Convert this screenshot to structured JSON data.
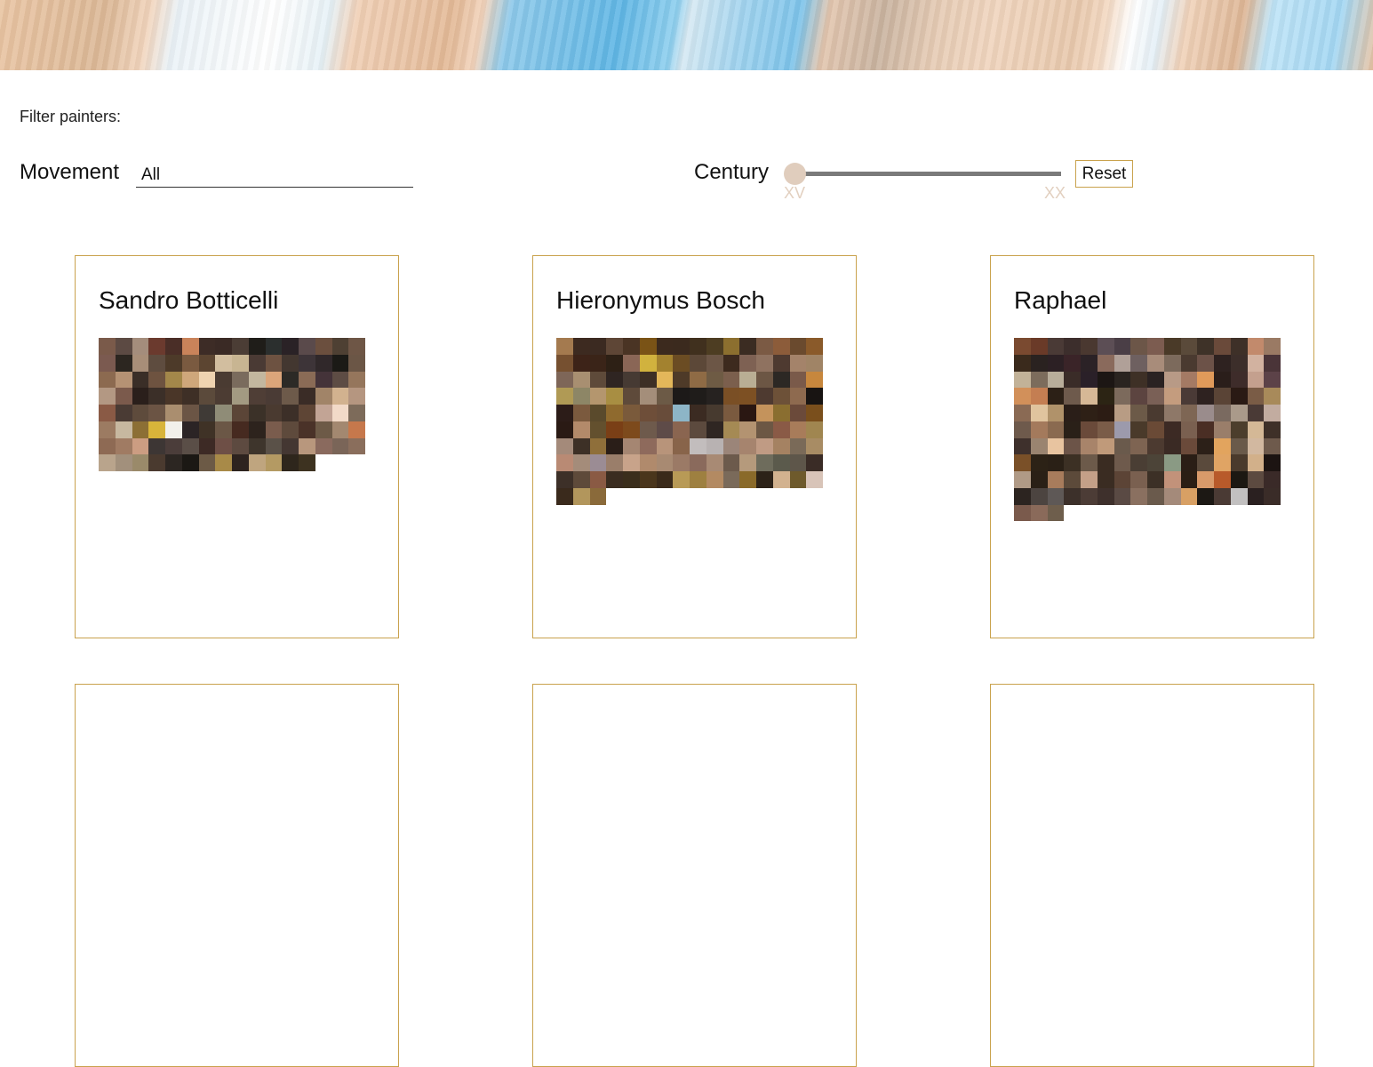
{
  "filters": {
    "heading": "Filter painters:",
    "movement_label": "Movement",
    "movement_value": "All",
    "century_label": "Century",
    "century_min_label": "XV",
    "century_max_label": "XX",
    "century_selected": "XV",
    "reset_label": "Reset"
  },
  "colors": {
    "accent_border": "#c9a24d",
    "slider_thumb": "#e0cdbd",
    "slider_track": "#7a7a7a",
    "tick_label": "#e2d0c0"
  },
  "painters": [
    {
      "name": "Sandro Botticelli",
      "palette": [
        "#7a5a4a",
        "#5c4a43",
        "#a48d7c",
        "#6b3a2e",
        "#4a2e27",
        "#c9835a",
        "#3d2c26",
        "#3a2a25",
        "#4b3d35",
        "#1f1d19",
        "#2b2f2e",
        "#2a2226",
        "#5a4a4b",
        "#6b4f3e",
        "#4e4033",
        "#6e5646",
        "#7b5a50",
        "#2c2620",
        "#a88e78",
        "#5e4c3f",
        "#4d3a29",
        "#7a5a40",
        "#5c4531",
        "#d2be9f",
        "#c8b592",
        "#4a3a34",
        "#6d5241",
        "#433730",
        "#3d3438",
        "#30282a",
        "#1b1a16",
        "#6b5646",
        "#8c6a50",
        "#b59274",
        "#3a2e27",
        "#6e5340",
        "#a3874a",
        "#cfa77b",
        "#efd3b0",
        "#4a3b32",
        "#7a6b5d",
        "#c3b79f",
        "#dba57a",
        "#2c2a26",
        "#8a6b56",
        "#443339",
        "#5d4c44",
        "#95765c",
        "#b39883",
        "#7b5a4c",
        "#2a1f1b",
        "#3b2f28",
        "#4a3628",
        "#3e2f26",
        "#5b4a3b",
        "#4c3c33",
        "#a39a82",
        "#4f3e36",
        "#4a3b35",
        "#6d5a4a",
        "#3a2c26",
        "#a18468",
        "#d2b28f",
        "#b59680",
        "#8a5a45",
        "#4a3b34",
        "#5e4b3c",
        "#6b5444",
        "#aa8e6f",
        "#6b5545",
        "#3f3a36",
        "#8f8c77",
        "#5b4537",
        "#3b3128",
        "#4a3a30",
        "#3c2f28",
        "#5e4535",
        "#c2a495",
        "#f2dac8",
        "#7d6b5a",
        "#9c7b62",
        "#c7b8a0",
        "#8c6f35",
        "#d8b43a",
        "#f2f0ea",
        "#2b2425",
        "#3f3226",
        "#6b5746",
        "#462a20",
        "#2d231d",
        "#7a5c4d",
        "#5e4a3c",
        "#4a3228",
        "#6d5a47",
        "#a38870",
        "#c6784c",
        "#8e6a54",
        "#a07b63",
        "#cc9d82",
        "#3d3634",
        "#4b3d3a",
        "#5a4e47",
        "#3d2a25",
        "#6e4f46",
        "#5d4a40",
        "#3e352c",
        "#5a5148",
        "#443732",
        "#b8977d",
        "#8a6a5e",
        "#7a6558",
        "#8a6e5c",
        "#b9a48c",
        "#a2907c",
        "#9a8a6a",
        "#4a3a2f",
        "#2c2622",
        "#1b1814",
        "#6c5a46",
        "#a88a48",
        "#2d231f",
        "#bfa57f",
        "#b49a63",
        "#2e261c",
        "#3d3220"
      ]
    },
    {
      "name": "Hieronymus Bosch",
      "palette": [
        "#a47a4f",
        "#3d2a20",
        "#3b2a21",
        "#5e4636",
        "#4a3424",
        "#7a5316",
        "#3c2a1e",
        "#3b2a1e",
        "#40301e",
        "#4d3d22",
        "#8c6f2f",
        "#3b2c22",
        "#7b5a44",
        "#8c5c3a",
        "#6a4a2e",
        "#8a5a2a",
        "#765030",
        "#3d2318",
        "#3a2418",
        "#2d2015",
        "#8a6656",
        "#d1b23e",
        "#a3822f",
        "#6b4c23",
        "#5c4838",
        "#6c5646",
        "#3d2a1e",
        "#7e6153",
        "#8f7260",
        "#4e3a30",
        "#a4836a",
        "#a08466",
        "#7e6658",
        "#a88f71",
        "#5e4a3a",
        "#2f2522",
        "#463a33",
        "#3d2f25",
        "#e3b75a",
        "#4e3a28",
        "#8f6b45",
        "#6e5b44",
        "#7b5f4d",
        "#b9ae94",
        "#6c5644",
        "#2c2824",
        "#7a5a4a",
        "#c7873d",
        "#b09a55",
        "#8d8666",
        "#b4966e",
        "#a88e42",
        "#5e4a3a",
        "#a48e7a",
        "#6c5a46",
        "#1c1918",
        "#1f1c1a",
        "#262220",
        "#7a4f25",
        "#7d5023",
        "#4e3a30",
        "#6d5138",
        "#8e6a4f",
        "#181412",
        "#2c1c18",
        "#7b5a3e",
        "#5a4a2c",
        "#8f6a2e",
        "#7a5a3b",
        "#6e4e39",
        "#684c3a",
        "#8db5c7",
        "#3b2b22",
        "#473a2f",
        "#7a5a3f",
        "#2a1712",
        "#c4935c",
        "#8a6e30",
        "#6b4a3a",
        "#7a4f1c",
        "#2a1a14",
        "#b38a6a",
        "#63502e",
        "#7a3f16",
        "#7d4a1c",
        "#6e5a4c",
        "#5e4b48",
        "#8a6550",
        "#5c4a3e",
        "#2f2622",
        "#a58a54",
        "#b39371",
        "#6c5744",
        "#8a5a46",
        "#a87c5a",
        "#a08650",
        "#a48a7a",
        "#3d3026",
        "#8f6f3a",
        "#2a1e18",
        "#a58672",
        "#8e6a5c",
        "#b8947a",
        "#88644a",
        "#c2bdbd",
        "#b8b2b2",
        "#9b8579",
        "#a6846e",
        "#c09b84",
        "#a58262",
        "#7a6a58",
        "#a88c64",
        "#b98a74",
        "#a48c7a",
        "#9b8c94",
        "#9a7e6a",
        "#c8a38a",
        "#b08a6c",
        "#a88a72",
        "#9b7a66",
        "#8a6a5c",
        "#a88a74",
        "#6c5a4c",
        "#b59a7c",
        "#6e6c5c",
        "#5b5a4c",
        "#5e564a",
        "#3a2c26",
        "#3d3028",
        "#5e4a3a",
        "#8a5a44",
        "#3a2c20",
        "#3a2e1c",
        "#4a361c",
        "#3a2a1a",
        "#b89a56",
        "#9e8040",
        "#b38a62",
        "#7a6a5a",
        "#8a6a2a",
        "#2c2218",
        "#d2b28f",
        "#6e5a2c",
        "#d8c4b8",
        "#3a2a1c",
        "#b2965c",
        "#8a6a3a"
      ]
    },
    {
      "name": "Raphael",
      "palette": [
        "#7a4a30",
        "#6a3a28",
        "#4a3a36",
        "#3c2e2c",
        "#4a3830",
        "#5c4e55",
        "#4a3e46",
        "#6c5648",
        "#7c5c50",
        "#4a3a28",
        "#5a4a3a",
        "#3e3228",
        "#6a4a3a",
        "#3e3028",
        "#c28a6c",
        "#9a7a64",
        "#3a2a1c",
        "#2a2220",
        "#2c2024",
        "#3a2428",
        "#2b2226",
        "#8a6a5c",
        "#b0a098",
        "#6e6060",
        "#a88c7a",
        "#7c6a5c",
        "#4a3a30",
        "#6c5248",
        "#2e2220",
        "#3c2e2a",
        "#d2b2a0",
        "#4a3438",
        "#c2b298",
        "#7c6c5c",
        "#b8ad9a",
        "#3a2c28",
        "#2a2028",
        "#1c1614",
        "#2a2420",
        "#3e3026",
        "#2a2222",
        "#b89a86",
        "#a47a64",
        "#e09a5a",
        "#2a1e1a",
        "#3e2c2a",
        "#c4a08e",
        "#5c4248",
        "#d2905a",
        "#c47e52",
        "#2c2016",
        "#6e5a4c",
        "#d6b896",
        "#2c2414",
        "#7c6a5c",
        "#5c4440",
        "#7a6056",
        "#c49c7e",
        "#4a3a36",
        "#2e2220",
        "#5a4436",
        "#2a1a14",
        "#7a5c46",
        "#a88a5a",
        "#8a6a54",
        "#e0c49e",
        "#b0926a",
        "#2a1e18",
        "#2e2016",
        "#2c1c14",
        "#b89c84",
        "#6c5a48",
        "#4a3a30",
        "#8e7868",
        "#7e6654",
        "#9a8c8c",
        "#7a6a60",
        "#aa9a8a",
        "#4a3a36",
        "#c2aca0",
        "#6e5a4c",
        "#a47a5c",
        "#8a6a50",
        "#2a2018",
        "#6a4a3a",
        "#7a5c48",
        "#9c9aac",
        "#4a3a2a",
        "#6a4a36",
        "#3c2a24",
        "#7a6050",
        "#4a2e24",
        "#9a7e6a",
        "#4c3e2c",
        "#d4b896",
        "#3e3028",
        "#3e302c",
        "#9a8470",
        "#e8c4a0",
        "#6c5448",
        "#a8846a",
        "#c09a7a",
        "#6a5a4c",
        "#7e6452",
        "#4c3a30",
        "#3a2a24",
        "#6a4a3a",
        "#2c2018",
        "#e2a45e",
        "#6a5a4a",
        "#d2b8a0",
        "#6e5a4c",
        "#7a5028",
        "#2c2216",
        "#2a2016",
        "#3c3024",
        "#6c5a4a",
        "#3a2c22",
        "#6e5a4c",
        "#4a3e34",
        "#4c4438",
        "#8a9a84",
        "#2a1e16",
        "#5a4a3c",
        "#e0a464",
        "#4a3a2c",
        "#d2b08a",
        "#1c1412",
        "#b09a86",
        "#2a2016",
        "#a87c5c",
        "#5c4a3a",
        "#c4a088",
        "#3a2c22",
        "#5c4436",
        "#7a6050",
        "#3c3026",
        "#c2927a",
        "#2a1e14",
        "#d89a6a",
        "#b85a2a",
        "#1c1812",
        "#5c4a40",
        "#3a2a28",
        "#2c2420",
        "#4c4440",
        "#5e5856",
        "#3c302a",
        "#4c3c36",
        "#3e302c",
        "#5a4a44",
        "#8a7060",
        "#6a5a4c",
        "#a48a7a",
        "#d8a064",
        "#1c1814",
        "#4a3a34",
        "#c2c0c0",
        "#2a2020",
        "#3a2c28",
        "#7a5a4c",
        "#8a6a5a",
        "#6e5e4c"
      ]
    }
  ]
}
